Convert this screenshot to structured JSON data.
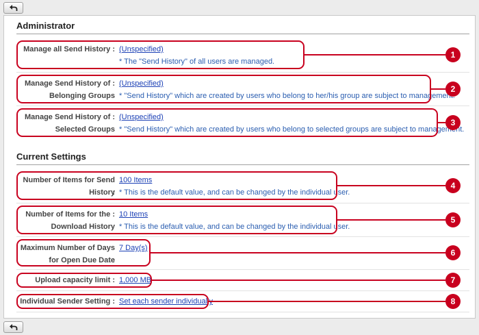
{
  "sections": {
    "administrator": "Administrator",
    "current_settings": "Current Settings"
  },
  "rows": [
    {
      "label_1": "Manage all Send History :",
      "label_2": "",
      "value": "(Unspecified)",
      "note": "* The \"Send History\" of all users are managed.",
      "badge": "1"
    },
    {
      "label_1": "Manage Send History of :",
      "label_2": "Belonging Groups",
      "value": "(Unspecified)",
      "note": "* \"Send History\" which are created by users who belong to her/his group are subject to management.",
      "badge": "2"
    },
    {
      "label_1": "Manage Send History of :",
      "label_2": "Selected Groups",
      "value": "(Unspecified)",
      "note": "* \"Send History\" which are created by users who belong to selected groups are subject to management.",
      "badge": "3"
    },
    {
      "label_1": "Number of Items for Send :",
      "label_2": "History",
      "value": "100 Items",
      "note": "* This is the default value, and can be changed by the individual user.",
      "badge": "4"
    },
    {
      "label_1": "Number of Items for the :",
      "label_2": "Download History",
      "value": "10 Items",
      "note": "* This is the default value, and can be changed by the individual user.",
      "badge": "5"
    },
    {
      "label_1": "Maximum Number of Days :",
      "label_2": "for Open Due Date",
      "value": "7 Day(s)",
      "note": "",
      "badge": "6"
    },
    {
      "label_1": "Upload capacity limit :",
      "label_2": "",
      "value": "1,000 MB",
      "note": "",
      "badge": "7"
    },
    {
      "label_1": "Individual Sender Setting :",
      "label_2": "",
      "value": "Set each sender individually",
      "note": "",
      "badge": "8"
    }
  ],
  "icons": {
    "back": "back-arrow-icon"
  },
  "colors": {
    "highlight": "#c8001e",
    "link": "#1a3fb5",
    "note": "#2a5db0"
  }
}
